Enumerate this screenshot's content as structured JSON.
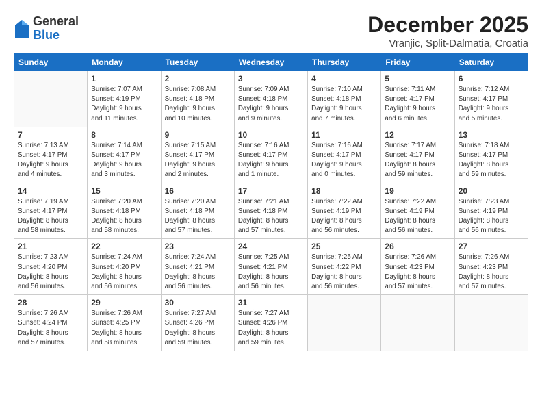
{
  "header": {
    "logo": {
      "general": "General",
      "blue": "Blue"
    },
    "title": "December 2025",
    "location": "Vranjic, Split-Dalmatia, Croatia"
  },
  "days_of_week": [
    "Sunday",
    "Monday",
    "Tuesday",
    "Wednesday",
    "Thursday",
    "Friday",
    "Saturday"
  ],
  "weeks": [
    [
      {
        "day": "",
        "info": ""
      },
      {
        "day": "1",
        "info": "Sunrise: 7:07 AM\nSunset: 4:19 PM\nDaylight: 9 hours\nand 11 minutes."
      },
      {
        "day": "2",
        "info": "Sunrise: 7:08 AM\nSunset: 4:18 PM\nDaylight: 9 hours\nand 10 minutes."
      },
      {
        "day": "3",
        "info": "Sunrise: 7:09 AM\nSunset: 4:18 PM\nDaylight: 9 hours\nand 9 minutes."
      },
      {
        "day": "4",
        "info": "Sunrise: 7:10 AM\nSunset: 4:18 PM\nDaylight: 9 hours\nand 7 minutes."
      },
      {
        "day": "5",
        "info": "Sunrise: 7:11 AM\nSunset: 4:17 PM\nDaylight: 9 hours\nand 6 minutes."
      },
      {
        "day": "6",
        "info": "Sunrise: 7:12 AM\nSunset: 4:17 PM\nDaylight: 9 hours\nand 5 minutes."
      }
    ],
    [
      {
        "day": "7",
        "info": "Sunrise: 7:13 AM\nSunset: 4:17 PM\nDaylight: 9 hours\nand 4 minutes."
      },
      {
        "day": "8",
        "info": "Sunrise: 7:14 AM\nSunset: 4:17 PM\nDaylight: 9 hours\nand 3 minutes."
      },
      {
        "day": "9",
        "info": "Sunrise: 7:15 AM\nSunset: 4:17 PM\nDaylight: 9 hours\nand 2 minutes."
      },
      {
        "day": "10",
        "info": "Sunrise: 7:16 AM\nSunset: 4:17 PM\nDaylight: 9 hours\nand 1 minute."
      },
      {
        "day": "11",
        "info": "Sunrise: 7:16 AM\nSunset: 4:17 PM\nDaylight: 9 hours\nand 0 minutes."
      },
      {
        "day": "12",
        "info": "Sunrise: 7:17 AM\nSunset: 4:17 PM\nDaylight: 8 hours\nand 59 minutes."
      },
      {
        "day": "13",
        "info": "Sunrise: 7:18 AM\nSunset: 4:17 PM\nDaylight: 8 hours\nand 59 minutes."
      }
    ],
    [
      {
        "day": "14",
        "info": "Sunrise: 7:19 AM\nSunset: 4:17 PM\nDaylight: 8 hours\nand 58 minutes."
      },
      {
        "day": "15",
        "info": "Sunrise: 7:20 AM\nSunset: 4:18 PM\nDaylight: 8 hours\nand 58 minutes."
      },
      {
        "day": "16",
        "info": "Sunrise: 7:20 AM\nSunset: 4:18 PM\nDaylight: 8 hours\nand 57 minutes."
      },
      {
        "day": "17",
        "info": "Sunrise: 7:21 AM\nSunset: 4:18 PM\nDaylight: 8 hours\nand 57 minutes."
      },
      {
        "day": "18",
        "info": "Sunrise: 7:22 AM\nSunset: 4:19 PM\nDaylight: 8 hours\nand 56 minutes."
      },
      {
        "day": "19",
        "info": "Sunrise: 7:22 AM\nSunset: 4:19 PM\nDaylight: 8 hours\nand 56 minutes."
      },
      {
        "day": "20",
        "info": "Sunrise: 7:23 AM\nSunset: 4:19 PM\nDaylight: 8 hours\nand 56 minutes."
      }
    ],
    [
      {
        "day": "21",
        "info": "Sunrise: 7:23 AM\nSunset: 4:20 PM\nDaylight: 8 hours\nand 56 minutes."
      },
      {
        "day": "22",
        "info": "Sunrise: 7:24 AM\nSunset: 4:20 PM\nDaylight: 8 hours\nand 56 minutes."
      },
      {
        "day": "23",
        "info": "Sunrise: 7:24 AM\nSunset: 4:21 PM\nDaylight: 8 hours\nand 56 minutes."
      },
      {
        "day": "24",
        "info": "Sunrise: 7:25 AM\nSunset: 4:21 PM\nDaylight: 8 hours\nand 56 minutes."
      },
      {
        "day": "25",
        "info": "Sunrise: 7:25 AM\nSunset: 4:22 PM\nDaylight: 8 hours\nand 56 minutes."
      },
      {
        "day": "26",
        "info": "Sunrise: 7:26 AM\nSunset: 4:23 PM\nDaylight: 8 hours\nand 57 minutes."
      },
      {
        "day": "27",
        "info": "Sunrise: 7:26 AM\nSunset: 4:23 PM\nDaylight: 8 hours\nand 57 minutes."
      }
    ],
    [
      {
        "day": "28",
        "info": "Sunrise: 7:26 AM\nSunset: 4:24 PM\nDaylight: 8 hours\nand 57 minutes."
      },
      {
        "day": "29",
        "info": "Sunrise: 7:26 AM\nSunset: 4:25 PM\nDaylight: 8 hours\nand 58 minutes."
      },
      {
        "day": "30",
        "info": "Sunrise: 7:27 AM\nSunset: 4:26 PM\nDaylight: 8 hours\nand 59 minutes."
      },
      {
        "day": "31",
        "info": "Sunrise: 7:27 AM\nSunset: 4:26 PM\nDaylight: 8 hours\nand 59 minutes."
      },
      {
        "day": "",
        "info": ""
      },
      {
        "day": "",
        "info": ""
      },
      {
        "day": "",
        "info": ""
      }
    ]
  ]
}
